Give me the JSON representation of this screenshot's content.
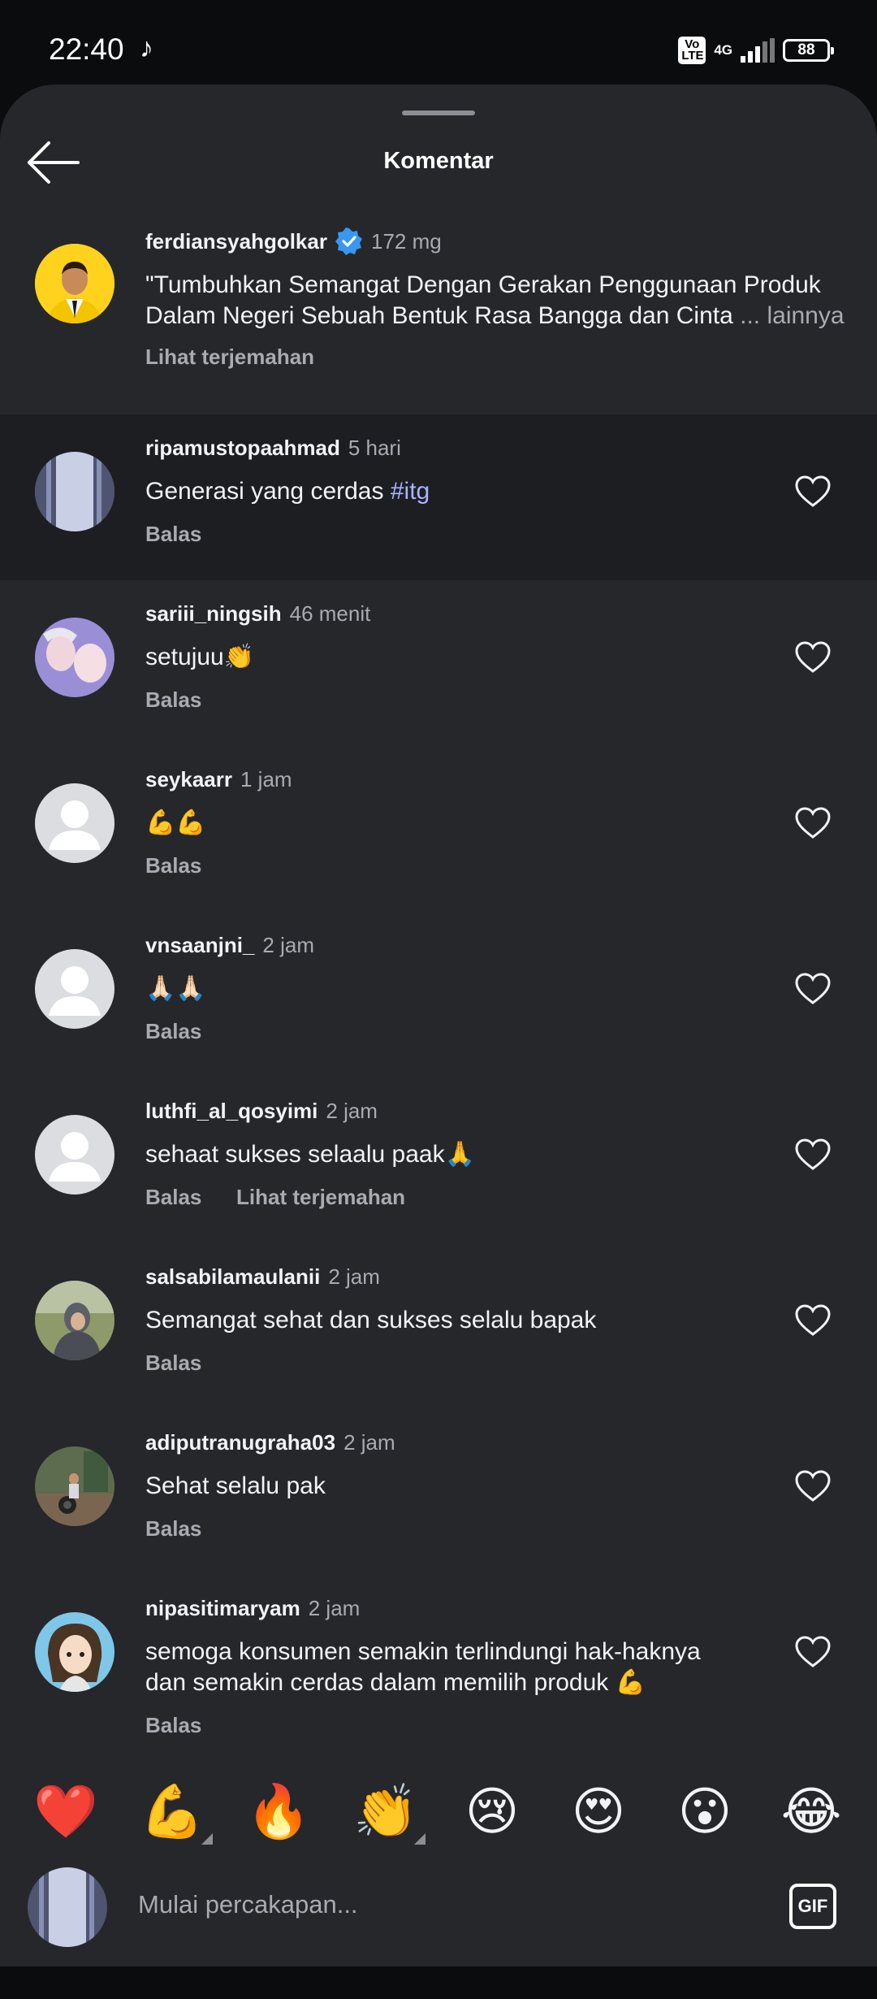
{
  "status_bar": {
    "time": "22:40",
    "network": "4G",
    "volte": "Vo LTE",
    "battery": "88"
  },
  "header": {
    "title": "Komentar"
  },
  "caption": {
    "username": "ferdiansyahgolkar",
    "time": "172 mg",
    "text_line1": "\"Tumbuhkan Semangat Dengan Gerakan Penggunaan Produk",
    "text_line2": "Dalam Negeri Sebuah Bentuk Rasa Bangga dan Cinta",
    "more": "... lainnya",
    "translate": "Lihat terjemahan"
  },
  "comments": [
    {
      "username": "ripamustopaahmad",
      "time": "5 hari",
      "text": "Generasi yang cerdas ",
      "hashtag": "#itg",
      "reply": "Balas",
      "translate": ""
    },
    {
      "username": "sariii_ningsih",
      "time": "46 menit",
      "text": "setujuu👏",
      "reply": "Balas",
      "translate": ""
    },
    {
      "username": "seykaarr",
      "time": "1 jam",
      "text": "💪💪",
      "reply": "Balas",
      "translate": ""
    },
    {
      "username": "vnsaanjni_",
      "time": "2 jam",
      "text": "🙏🏻🙏🏻",
      "reply": "Balas",
      "translate": ""
    },
    {
      "username": "luthfi_al_qosyimi",
      "time": "2 jam",
      "text": "sehaat sukses selaalu paak🙏",
      "reply": "Balas",
      "translate": "Lihat terjemahan"
    },
    {
      "username": "salsabilamaulanii",
      "time": "2 jam",
      "text": "Semangat sehat dan sukses selalu bapak",
      "reply": "Balas",
      "translate": ""
    },
    {
      "username": "adiputranugraha03",
      "time": "2 jam",
      "text": "Sehat selalu pak",
      "reply": "Balas",
      "translate": ""
    },
    {
      "username": "nipasitimaryam",
      "time": "2 jam",
      "text": "semoga konsumen semakin terlindungi hak-haknya",
      "text2": "dan semakin cerdas dalam memilih produk 💪",
      "reply": "Balas",
      "translate": ""
    }
  ],
  "quick_emojis": [
    "❤️",
    "💪",
    "🔥",
    "👏",
    "😢",
    "😍",
    "😮",
    "😂"
  ],
  "input": {
    "placeholder": "Mulai percakapan...",
    "gif_label": "GIF"
  },
  "colors": {
    "sheet": "#25272b",
    "highlight": "#1d1e22",
    "hashtag": "#a9b4ff",
    "verified": "#3897f0",
    "muted": "#a8abb1"
  }
}
